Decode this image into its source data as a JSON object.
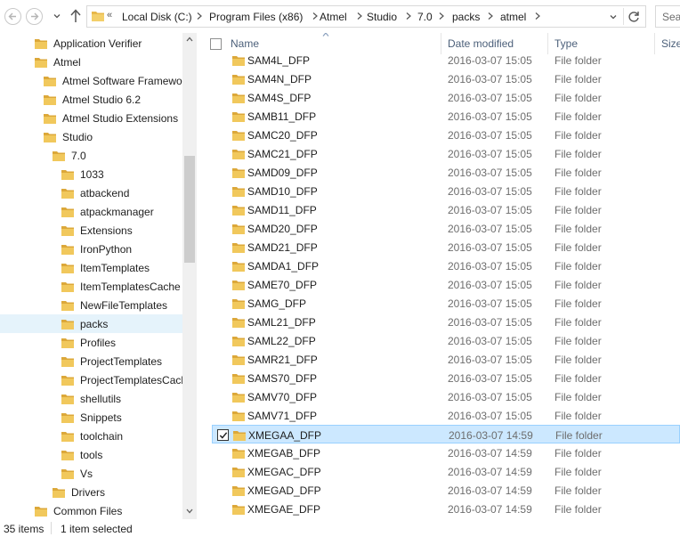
{
  "address": {
    "chevrons": "«",
    "crumbs": [
      "Local Disk (C:)",
      "Program Files (x86)",
      "Atmel",
      "Studio",
      "7.0",
      "packs",
      "atmel"
    ]
  },
  "search": {
    "placeholder": "Sea"
  },
  "nav": {
    "items": [
      {
        "label": "Application Verifier"
      },
      {
        "label": "Atmel"
      },
      {
        "label": "Atmel Software Framewor"
      },
      {
        "label": "Atmel Studio 6.2"
      },
      {
        "label": "Atmel Studio Extensions"
      },
      {
        "label": "Studio"
      },
      {
        "label": "7.0"
      },
      {
        "label": "1033"
      },
      {
        "label": "atbackend"
      },
      {
        "label": "atpackmanager"
      },
      {
        "label": "Extensions"
      },
      {
        "label": "IronPython"
      },
      {
        "label": "ItemTemplates"
      },
      {
        "label": "ItemTemplatesCache"
      },
      {
        "label": "NewFileTemplates"
      },
      {
        "label": "packs"
      },
      {
        "label": "Profiles"
      },
      {
        "label": "ProjectTemplates"
      },
      {
        "label": "ProjectTemplatesCach"
      },
      {
        "label": "shellutils"
      },
      {
        "label": "Snippets"
      },
      {
        "label": "toolchain"
      },
      {
        "label": "tools"
      },
      {
        "label": "Vs"
      },
      {
        "label": "Drivers"
      },
      {
        "label": "Common Files"
      }
    ]
  },
  "columns": {
    "name": "Name",
    "date": "Date modified",
    "type": "Type",
    "size": "Size"
  },
  "files": [
    {
      "name": "SAM4L_DFP",
      "date": "2016-03-07 15:05",
      "type": "File folder"
    },
    {
      "name": "SAM4N_DFP",
      "date": "2016-03-07 15:05",
      "type": "File folder"
    },
    {
      "name": "SAM4S_DFP",
      "date": "2016-03-07 15:05",
      "type": "File folder"
    },
    {
      "name": "SAMB11_DFP",
      "date": "2016-03-07 15:05",
      "type": "File folder"
    },
    {
      "name": "SAMC20_DFP",
      "date": "2016-03-07 15:05",
      "type": "File folder"
    },
    {
      "name": "SAMC21_DFP",
      "date": "2016-03-07 15:05",
      "type": "File folder"
    },
    {
      "name": "SAMD09_DFP",
      "date": "2016-03-07 15:05",
      "type": "File folder"
    },
    {
      "name": "SAMD10_DFP",
      "date": "2016-03-07 15:05",
      "type": "File folder"
    },
    {
      "name": "SAMD11_DFP",
      "date": "2016-03-07 15:05",
      "type": "File folder"
    },
    {
      "name": "SAMD20_DFP",
      "date": "2016-03-07 15:05",
      "type": "File folder"
    },
    {
      "name": "SAMD21_DFP",
      "date": "2016-03-07 15:05",
      "type": "File folder"
    },
    {
      "name": "SAMDA1_DFP",
      "date": "2016-03-07 15:05",
      "type": "File folder"
    },
    {
      "name": "SAME70_DFP",
      "date": "2016-03-07 15:05",
      "type": "File folder"
    },
    {
      "name": "SAMG_DFP",
      "date": "2016-03-07 15:05",
      "type": "File folder"
    },
    {
      "name": "SAML21_DFP",
      "date": "2016-03-07 15:05",
      "type": "File folder"
    },
    {
      "name": "SAML22_DFP",
      "date": "2016-03-07 15:05",
      "type": "File folder"
    },
    {
      "name": "SAMR21_DFP",
      "date": "2016-03-07 15:05",
      "type": "File folder"
    },
    {
      "name": "SAMS70_DFP",
      "date": "2016-03-07 15:05",
      "type": "File folder"
    },
    {
      "name": "SAMV70_DFP",
      "date": "2016-03-07 15:05",
      "type": "File folder"
    },
    {
      "name": "SAMV71_DFP",
      "date": "2016-03-07 15:05",
      "type": "File folder"
    },
    {
      "name": "XMEGAA_DFP",
      "date": "2016-03-07 14:59",
      "type": "File folder"
    },
    {
      "name": "XMEGAB_DFP",
      "date": "2016-03-07 14:59",
      "type": "File folder"
    },
    {
      "name": "XMEGAC_DFP",
      "date": "2016-03-07 14:59",
      "type": "File folder"
    },
    {
      "name": "XMEGAD_DFP",
      "date": "2016-03-07 14:59",
      "type": "File folder"
    },
    {
      "name": "XMEGAE_DFP",
      "date": "2016-03-07 14:59",
      "type": "File folder"
    }
  ],
  "status": {
    "count": "35 items",
    "selected": "1 item selected"
  },
  "colors": {
    "selection_bg": "#cce8ff",
    "selection_border": "#99d1ff",
    "folder": "#e8b84a",
    "header_text": "#4c607a"
  }
}
